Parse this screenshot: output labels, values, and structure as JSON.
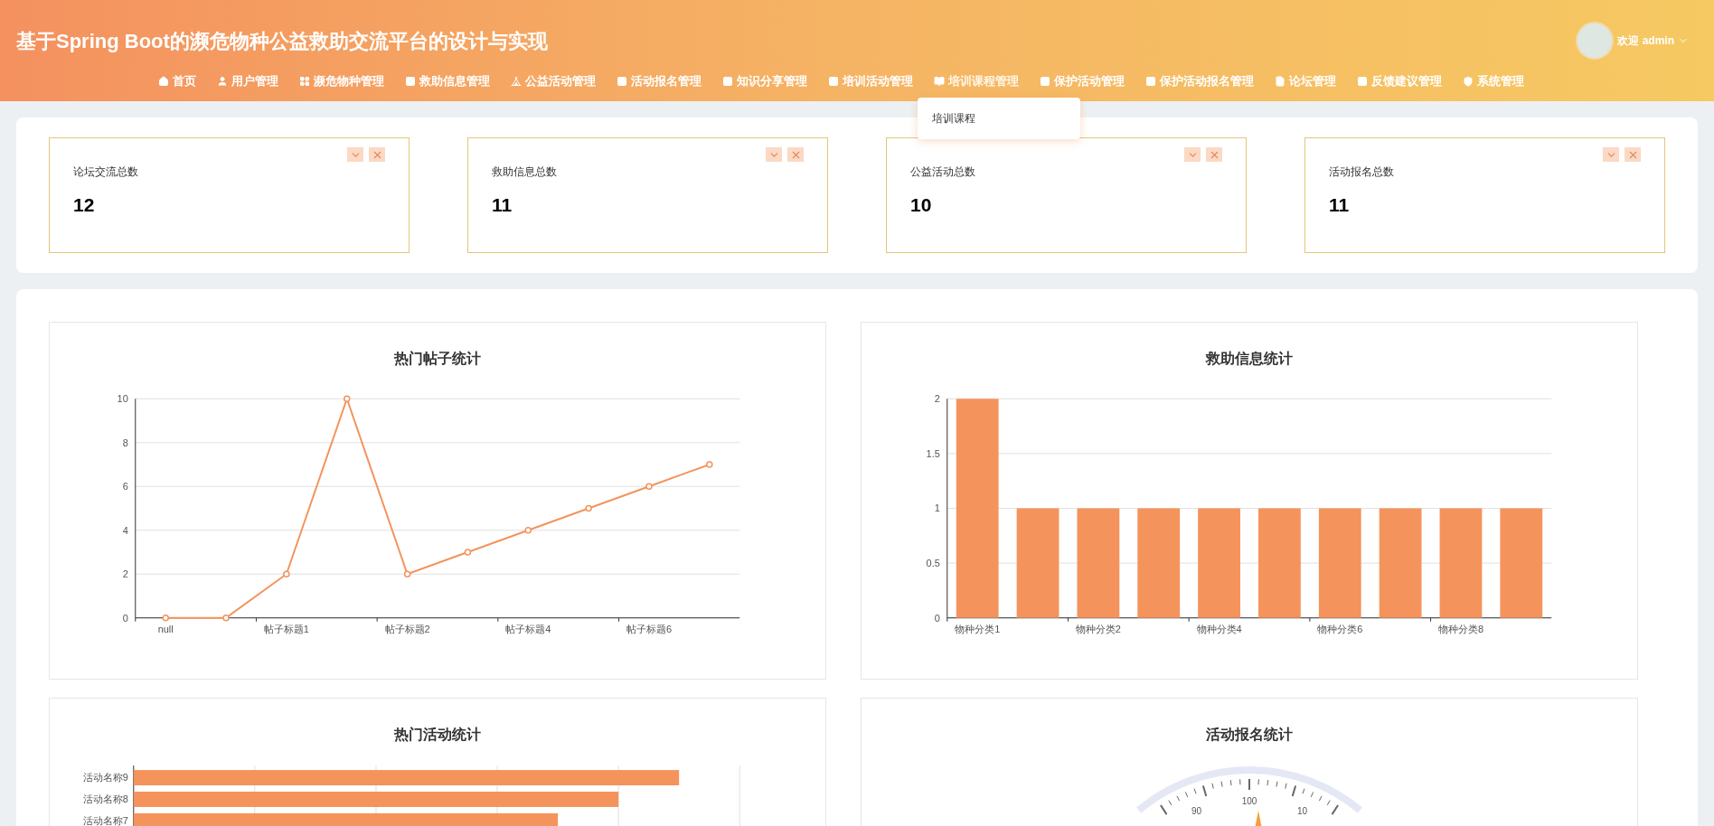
{
  "header": {
    "title": "基于Spring Boot的濒危物种公益救助交流平台的设计与实现",
    "user": "欢迎 admin"
  },
  "nav": [
    {
      "label": "首页",
      "expanded": false
    },
    {
      "label": "用户管理",
      "expanded": false
    },
    {
      "label": "濒危物种管理",
      "expanded": false
    },
    {
      "label": "救助信息管理",
      "expanded": false
    },
    {
      "label": "公益活动管理",
      "expanded": false
    },
    {
      "label": "活动报名管理",
      "expanded": false
    },
    {
      "label": "知识分享管理",
      "expanded": false
    },
    {
      "label": "培训活动管理",
      "expanded": false
    },
    {
      "label": "培训课程管理",
      "expanded": true,
      "children": [
        "培训课程"
      ]
    },
    {
      "label": "保护活动管理",
      "expanded": false
    },
    {
      "label": "保护活动报名管理",
      "expanded": false
    },
    {
      "label": "论坛管理",
      "expanded": false
    },
    {
      "label": "反馈建议管理",
      "expanded": false
    },
    {
      "label": "系统管理",
      "expanded": false
    }
  ],
  "stats": [
    {
      "label": "论坛交流总数",
      "value": "12"
    },
    {
      "label": "救助信息总数",
      "value": "11"
    },
    {
      "label": "公益活动总数",
      "value": "10"
    },
    {
      "label": "活动报名总数",
      "value": "11"
    }
  ],
  "charts": [
    {
      "title": "热门帖子统计",
      "chart_data": {
        "type": "line",
        "grid": true,
        "categories": [
          "null",
          null,
          "帖子标题1",
          null,
          "帖子标题2",
          null,
          "帖子标题4",
          null,
          "帖子标题6",
          null
        ],
        "series": [
          {
            "color": "#f4935c",
            "marker": true,
            "values": [
              0,
              0,
              2,
              10,
              2,
              3,
              4,
              5,
              6,
              7
            ]
          }
        ],
        "ylim": [
          0,
          10
        ],
        "yticks": [
          0,
          2,
          4,
          6,
          8,
          10
        ]
      }
    },
    {
      "title": "救助信息统计",
      "chart_data": {
        "type": "bar",
        "grid": true,
        "categories": [
          "物种分类1",
          null,
          "物种分类2",
          null,
          "物种分类4",
          null,
          "物种分类6",
          null,
          "物种分类8",
          null
        ],
        "series": [
          {
            "color": "#f4935c",
            "values": [
              2,
              1,
              1,
              1,
              1,
              1,
              1,
              1,
              1,
              1
            ]
          }
        ],
        "ylim": [
          0,
          2
        ],
        "yticks": [
          0,
          0.5,
          1,
          1.5,
          2
        ]
      }
    },
    {
      "title": "热门活动统计",
      "bar_labels": [
        "活动名称9",
        "活动名称8",
        "活动名称7"
      ]
    },
    {
      "title": "活动报名统计",
      "gauge_labels": [
        "90",
        "100",
        "10"
      ]
    }
  ]
}
